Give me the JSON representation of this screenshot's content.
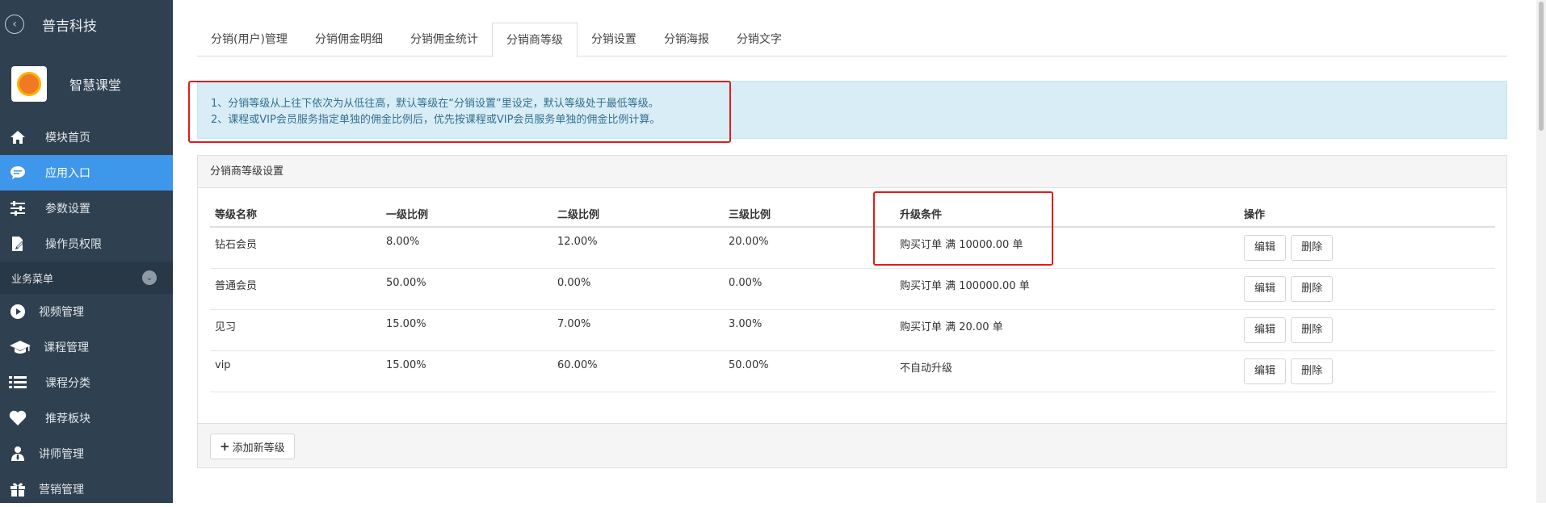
{
  "app": {
    "brand_name": "普吉科技",
    "school_name": "智慧课堂"
  },
  "sidebar": {
    "items": [
      {
        "label": "模块首页",
        "icon": "home-icon"
      },
      {
        "label": "应用入口",
        "icon": "chat-icon",
        "active": true
      },
      {
        "label": "参数设置",
        "icon": "sliders-icon"
      },
      {
        "label": "操作员权限",
        "icon": "edit-doc-icon"
      }
    ],
    "section_label": "业务菜单",
    "section_items": [
      {
        "label": "视频管理",
        "icon": "play-icon"
      },
      {
        "label": "课程管理",
        "icon": "graduation-cap-icon"
      },
      {
        "label": "课程分类",
        "icon": "list-icon"
      },
      {
        "label": "推荐板块",
        "icon": "heart-icon"
      },
      {
        "label": "讲师管理",
        "icon": "user-tie-icon"
      },
      {
        "label": "营销管理",
        "icon": "gift-icon"
      }
    ]
  },
  "tabs": [
    {
      "label": "分销(用户)管理"
    },
    {
      "label": "分销佣金明细"
    },
    {
      "label": "分销佣金统计"
    },
    {
      "label": "分销商等级",
      "active": true
    },
    {
      "label": "分销设置"
    },
    {
      "label": "分销海报"
    },
    {
      "label": "分销文字"
    }
  ],
  "notice": {
    "line1": "1、分销等级从上往下依次为从低往高，默认等级在“分销设置”里设定，默认等级处于最低等级。",
    "line2": "2、课程或VIP会员服务指定单独的佣金比例后，优先按课程或VIP会员服务单独的佣金比例计算。"
  },
  "panel": {
    "title": "分销商等级设置",
    "columns": [
      "等级名称",
      "一级比例",
      "二级比例",
      "三级比例",
      "升级条件",
      "操作"
    ],
    "rows": [
      {
        "name": "钻石会员",
        "l1": "8.00%",
        "l2": "12.00%",
        "l3": "20.00%",
        "condition": "购买订单 满 10000.00 单"
      },
      {
        "name": "普通会员",
        "l1": "50.00%",
        "l2": "0.00%",
        "l3": "0.00%",
        "condition": "购买订单 满 100000.00 单"
      },
      {
        "name": "见习",
        "l1": "15.00%",
        "l2": "7.00%",
        "l3": "3.00%",
        "condition": "购买订单 满 20.00 单"
      },
      {
        "name": "vip",
        "l1": "15.00%",
        "l2": "60.00%",
        "l3": "50.00%",
        "condition": "不自动升级"
      }
    ],
    "edit_label": "编辑",
    "delete_label": "删除",
    "add_label": "添加新等级"
  },
  "colors": {
    "sidebar_bg": "#2f4050",
    "active_blue": "#3e97ea",
    "highlight_red": "#e21b1b",
    "notice_bg": "#d9edf7"
  }
}
